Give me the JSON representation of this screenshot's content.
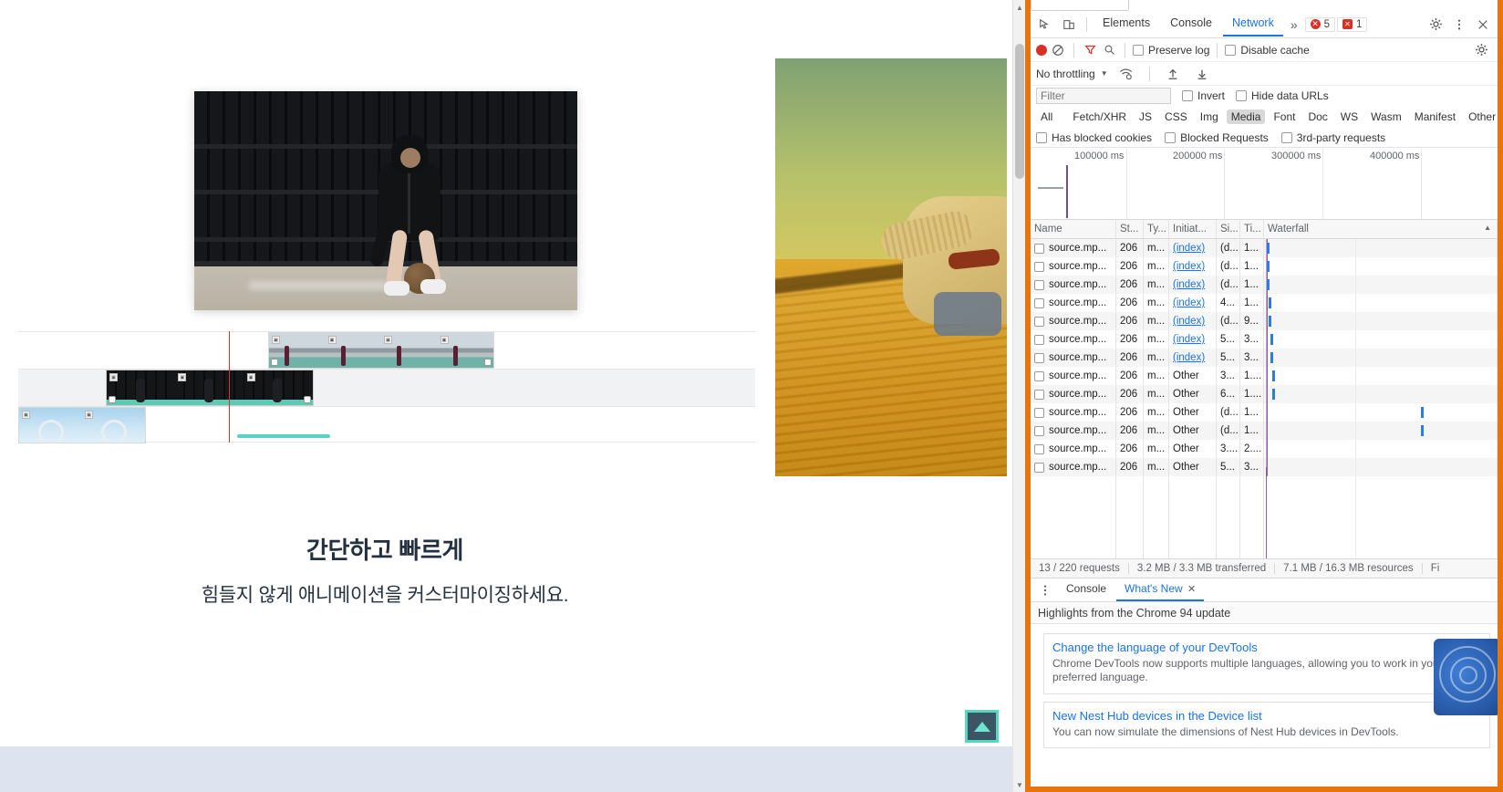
{
  "page": {
    "headline": "간단하고 빠르게",
    "subhead": "힘들지 않게 애니메이션을 커스터마이징하세요.",
    "to_top_label": "scroll-to-top",
    "timeline": {
      "tracks": [
        {
          "name": "track-upper",
          "clips": [
            {
              "thumbs": 4,
              "art": "th-court"
            }
          ]
        },
        {
          "name": "track-middle",
          "clips": [
            {
              "thumbs": 3,
              "art": "th-dark"
            }
          ]
        },
        {
          "name": "track-lower",
          "clips": [
            {
              "thumbs": 2,
              "art": "th-sky"
            }
          ]
        }
      ]
    }
  },
  "devtools": {
    "tabs": [
      {
        "label": "Elements",
        "active": false
      },
      {
        "label": "Console",
        "active": false
      },
      {
        "label": "Network",
        "active": true
      }
    ],
    "more_label": "»",
    "error_count": "5",
    "warning_count": "1",
    "icons": {
      "inspect": "inspect-element-icon",
      "device": "device-toolbar-icon",
      "settings": "gear-icon",
      "menu": "kebab-menu-icon",
      "close": "close-icon"
    },
    "network": {
      "record_label": "record-button",
      "clear_label": "clear-button",
      "filter_toggle_label": "filter-icon",
      "search_label": "search-icon",
      "preserve_log": "Preserve log",
      "disable_cache": "Disable cache",
      "throttling": "No throttling",
      "filter_placeholder": "Filter",
      "invert": "Invert",
      "hide_data_urls": "Hide data URLs",
      "types": [
        "All",
        "Fetch/XHR",
        "JS",
        "CSS",
        "Img",
        "Media",
        "Font",
        "Doc",
        "WS",
        "Wasm",
        "Manifest",
        "Other"
      ],
      "selected_type": "Media",
      "has_blocked_cookies": "Has blocked cookies",
      "blocked_requests": "Blocked Requests",
      "third_party_requests": "3rd-party requests",
      "overview_ticks": [
        "100000 ms",
        "200000 ms",
        "300000 ms",
        "400000 ms"
      ],
      "columns": [
        "Name",
        "St...",
        "Ty...",
        "Initiat...",
        "Si...",
        "Ti...",
        "Waterfall"
      ],
      "rows": [
        {
          "name": "source.mp...",
          "status": "206",
          "type": "m...",
          "initiator": "(index)",
          "initiator_link": true,
          "size": "(d...",
          "time": "1..."
        },
        {
          "name": "source.mp...",
          "status": "206",
          "type": "m...",
          "initiator": "(index)",
          "initiator_link": true,
          "size": "(d...",
          "time": "1..."
        },
        {
          "name": "source.mp...",
          "status": "206",
          "type": "m...",
          "initiator": "(index)",
          "initiator_link": true,
          "size": "(d...",
          "time": "1..."
        },
        {
          "name": "source.mp...",
          "status": "206",
          "type": "m...",
          "initiator": "(index)",
          "initiator_link": true,
          "size": "4...",
          "time": "1..."
        },
        {
          "name": "source.mp...",
          "status": "206",
          "type": "m...",
          "initiator": "(index)",
          "initiator_link": true,
          "size": "(d...",
          "time": "9..."
        },
        {
          "name": "source.mp...",
          "status": "206",
          "type": "m...",
          "initiator": "(index)",
          "initiator_link": true,
          "size": "5...",
          "time": "3..."
        },
        {
          "name": "source.mp...",
          "status": "206",
          "type": "m...",
          "initiator": "(index)",
          "initiator_link": true,
          "size": "5...",
          "time": "3..."
        },
        {
          "name": "source.mp...",
          "status": "206",
          "type": "m...",
          "initiator": "Other",
          "initiator_link": false,
          "size": "3...",
          "time": "1...."
        },
        {
          "name": "source.mp...",
          "status": "206",
          "type": "m...",
          "initiator": "Other",
          "initiator_link": false,
          "size": "6...",
          "time": "1...."
        },
        {
          "name": "source.mp...",
          "status": "206",
          "type": "m...",
          "initiator": "Other",
          "initiator_link": false,
          "size": "(d...",
          "time": "1..."
        },
        {
          "name": "source.mp...",
          "status": "206",
          "type": "m...",
          "initiator": "Other",
          "initiator_link": false,
          "size": "(d...",
          "time": "1..."
        },
        {
          "name": "source.mp...",
          "status": "206",
          "type": "m...",
          "initiator": "Other",
          "initiator_link": false,
          "size": "3....",
          "time": "2...."
        },
        {
          "name": "source.mp...",
          "status": "206",
          "type": "m...",
          "initiator": "Other",
          "initiator_link": false,
          "size": "5...",
          "time": "3..."
        }
      ],
      "summary": {
        "requests": "13 / 220 requests",
        "transferred": "3.2 MB / 3.3 MB transferred",
        "resources": "7.1 MB / 16.3 MB resources",
        "finish": "Fi"
      }
    },
    "drawer": {
      "menu_label": "kebab-menu-icon",
      "tabs": [
        {
          "label": "Console",
          "active": false
        },
        {
          "label": "What's New",
          "active": true
        }
      ],
      "close_label": "✕",
      "whats_new": {
        "heading": "Highlights from the Chrome 94 update",
        "cards": [
          {
            "title": "Change the language of your DevTools",
            "desc": "Chrome DevTools now supports multiple languages, allowing you to work in your preferred language."
          },
          {
            "title": "New Nest Hub devices in the Device list",
            "desc": "You can now simulate the dimensions of Nest Hub devices in DevTools."
          }
        ]
      }
    }
  },
  "colors": {
    "devtools_border": "#e8740c",
    "accent_blue": "#1a73e8",
    "error_red": "#d93025",
    "teal": "#5ad6c0",
    "headline": "#23303f"
  }
}
